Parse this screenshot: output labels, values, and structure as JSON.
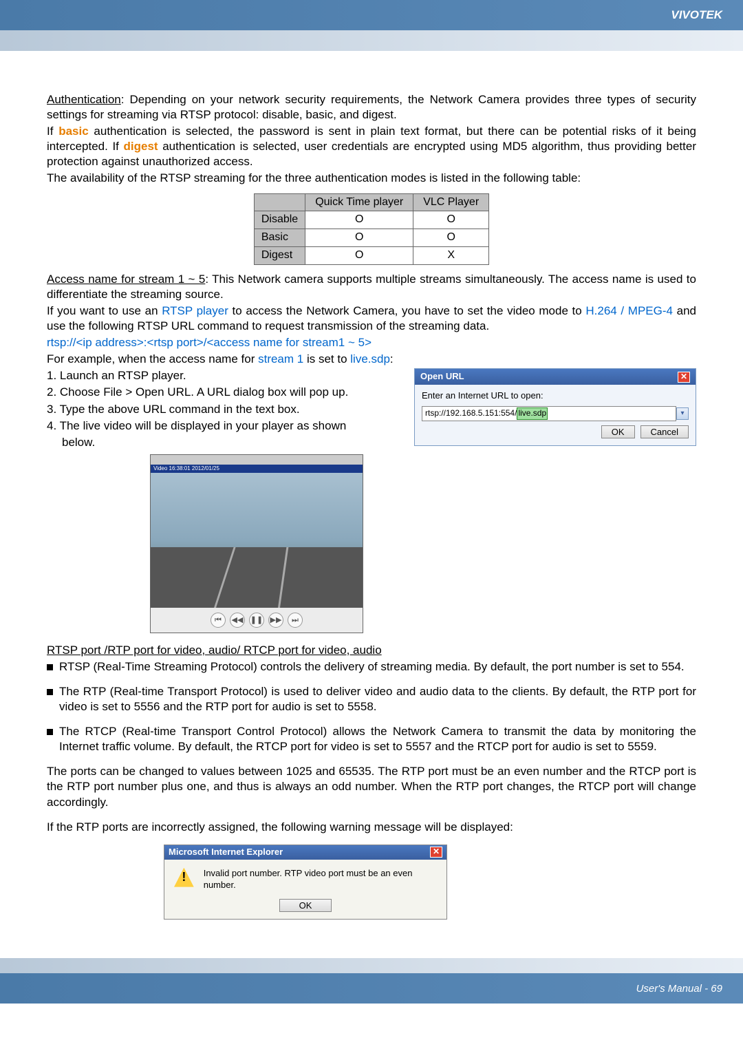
{
  "header": {
    "brand": "VIVOTEK"
  },
  "auth": {
    "heading": "Authentication",
    "intro1": ": Depending on your network security requirements, the Network Camera provides three types of security settings for streaming via RTSP protocol: disable, basic, and digest.",
    "intro2a": "If ",
    "basic": "basic",
    "intro2b": " authentication is selected, the password is sent in plain text format, but there can be potential risks of it being intercepted. If ",
    "digest": "digest",
    "intro2c": " authentication is selected, user credentials are encrypted using MD5 algorithm, thus providing better protection against unauthorized access.",
    "intro3": "The availability of the RTSP streaming for the three authentication modes is listed in the following table:"
  },
  "table": {
    "col_qt": "Quick Time player",
    "col_vlc": "VLC Player",
    "rows": [
      {
        "label": "Disable",
        "qt": "O",
        "vlc": "O"
      },
      {
        "label": "Basic",
        "qt": "O",
        "vlc": "O"
      },
      {
        "label": "Digest",
        "qt": "O",
        "vlc": "X"
      }
    ]
  },
  "access": {
    "heading": "Access name for stream 1 ~ 5",
    "text1": ": This Network camera supports multiple streams simultaneously. The access name is used to differentiate the streaming source.",
    "text2a": "If you want to use an ",
    "rtsp_player": "RTSP player",
    "text2b": " to access the Network Camera, you have to set the video mode to ",
    "codec": "H.264 / MPEG-4",
    "text2c": " and use the following RTSP URL command to request transmission of the streaming data.",
    "url": "rtsp://<ip address>:<rtsp port>/<access name for stream1 ~ 5>",
    "ex_a": "For example, when the access name for ",
    "ex_stream": "stream 1",
    "ex_b": " is set to ",
    "ex_sdp": "live.sdp",
    "ex_c": ":"
  },
  "steps": {
    "s1": "1. Launch an RTSP player.",
    "s2": "2. Choose File > Open URL. A URL dialog box will pop up.",
    "s3": "3. Type the above URL command in the text box.",
    "s4": "4. The live video will be displayed in your player as shown",
    "s4b": "below."
  },
  "dialog": {
    "title": "Open URL",
    "label": "Enter an Internet URL to open:",
    "url_pre": "rtsp://192.168.5.151:554/",
    "url_hi": "live.sdp",
    "ok": "OK",
    "cancel": "Cancel"
  },
  "player": {
    "bar": "Video 16:38:01 2012/01/25"
  },
  "rtsp_ports": {
    "heading": "RTSP port /RTP port for video, audio/ RTCP port for video, audio",
    "b1": "RTSP (Real-Time Streaming Protocol) controls the delivery of streaming media. By default, the port number is set to 554.",
    "b2": "The RTP (Real-time Transport Protocol) is used to deliver video and audio data to the clients. By default, the RTP port for video is set to 5556 and the RTP port for audio is set to 5558.",
    "b3": "The RTCP (Real-time Transport Control Protocol) allows the Network Camera to transmit the data by monitoring the Internet traffic volume. By default, the RTCP port for video is set to 5557 and the RTCP port for audio is set to 5559.",
    "p4": "The ports can be changed to values between 1025 and 65535. The RTP port must be an even number and the RTCP port is the RTP port number plus one, and thus is always an odd number. When the RTP port changes, the RTCP port will change accordingly.",
    "p5": "If the RTP ports are incorrectly assigned, the following warning message will be displayed:"
  },
  "err": {
    "title": "Microsoft Internet Explorer",
    "msg": "Invalid port number. RTP video port must be an even number.",
    "ok": "OK"
  },
  "footer": {
    "text": "User's Manual - 69"
  }
}
